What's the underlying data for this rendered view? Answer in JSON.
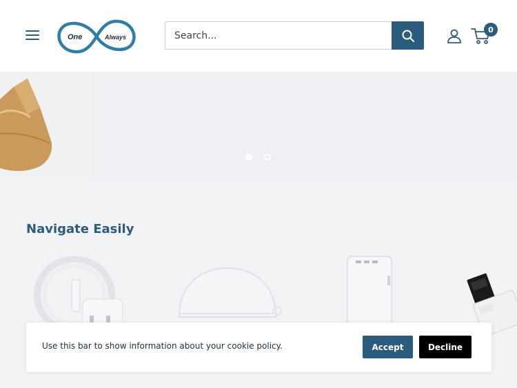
{
  "header": {
    "logo": {
      "word_left": "One",
      "word_right": "Always"
    },
    "search": {
      "placeholder": "Search..."
    },
    "cart": {
      "count": "0"
    }
  },
  "hero": {
    "slide_count": 2,
    "active_slide": 1
  },
  "collection": {
    "title": "Navigate Easily"
  },
  "cookie_bar": {
    "text": "Use this bar to show information about your cookie policy.",
    "accept_label": "Accept",
    "decline_label": "Decline"
  },
  "colors": {
    "brand": "#2b5b7d",
    "logo_ring": "#2e7fa8",
    "background": "#f2f3f5",
    "decline": "#000000"
  },
  "icons": [
    "hamburger-icon",
    "search-icon",
    "account-icon",
    "cart-icon"
  ]
}
